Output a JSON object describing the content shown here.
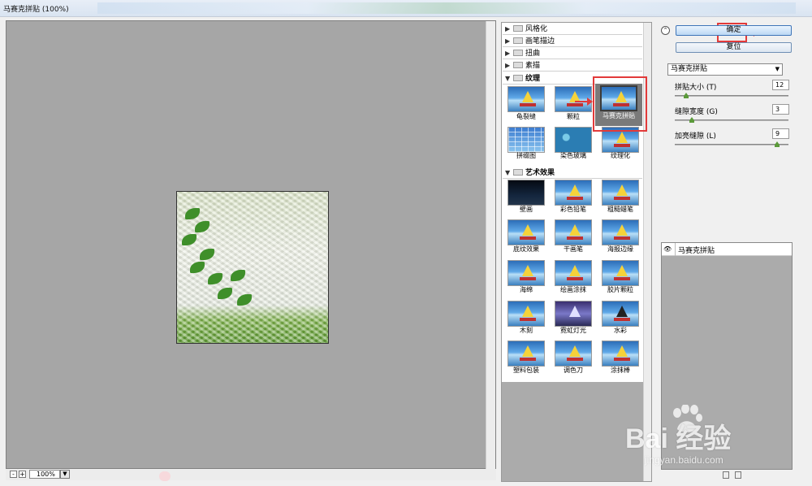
{
  "window": {
    "title": "马赛克拼贴 (100%)"
  },
  "preview": {
    "zoom": "100%",
    "zoom_out": "-",
    "zoom_in": "+"
  },
  "categories": [
    {
      "label": "风格化",
      "expanded": false
    },
    {
      "label": "画笔描边",
      "expanded": false
    },
    {
      "label": "扭曲",
      "expanded": false
    },
    {
      "label": "素描",
      "expanded": false
    },
    {
      "label": "纹理",
      "expanded": true
    },
    {
      "label": "艺术效果",
      "expanded": true
    }
  ],
  "texture_filters": [
    "龟裂缝",
    "颗粒",
    "马赛克拼贴",
    "拼缀图",
    "染色玻璃",
    "纹理化"
  ],
  "artistic_filters": [
    "壁画",
    "彩色铅笔",
    "粗糙蜡笔",
    "底纹效果",
    "干画笔",
    "海报边缘",
    "海绵",
    "绘画涂抹",
    "胶片颗粒",
    "木刻",
    "霓虹灯光",
    "水彩",
    "塑料包装",
    "调色刀",
    "涂抹棒"
  ],
  "selected_filter": "马赛克拼贴",
  "buttons": {
    "ok": "确定",
    "reset": "复位"
  },
  "filter_select": {
    "value": "马赛克拼贴"
  },
  "params": [
    {
      "label": "拼贴大小 (T)",
      "value": "12",
      "fraction": 0.1
    },
    {
      "label": "缝隙宽度 (G)",
      "value": "3",
      "fraction": 0.15
    },
    {
      "label": "加亮缝隙 (L)",
      "value": "9",
      "fraction": 0.9
    }
  ],
  "effect_layers": [
    {
      "name": "马赛克拼贴",
      "visible": true
    }
  ],
  "watermark": {
    "main": "Bai  经验",
    "sub": "jingyan.baidu.com"
  },
  "colors": {
    "preview_bg": "#a6a6a6",
    "highlight": "#e23a3a",
    "accent_button": "#3f75b8"
  }
}
